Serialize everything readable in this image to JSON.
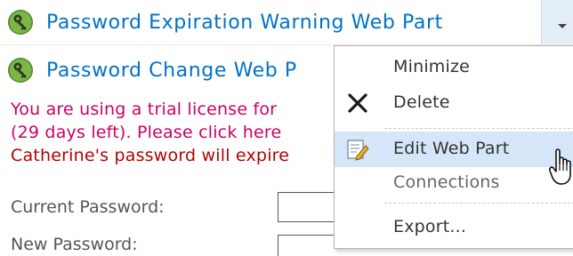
{
  "webparts": {
    "expiration_title": "Password Expiration Warning Web Part",
    "change_title": "Password Change Web P"
  },
  "messages": {
    "trial_line1": "You are using a trial license for",
    "trial_line2": "(29 days left). Please click here",
    "expire_line": "Catherine's password will expire"
  },
  "form": {
    "current_password_label": "Current Password:",
    "new_password_label": "New Password:"
  },
  "menu": {
    "minimize": "Minimize",
    "delete": "Delete",
    "edit_web_part": "Edit Web Part",
    "connections": "Connections",
    "export": "Export..."
  },
  "icons": {
    "webpart": "key-icon",
    "delete": "delete-x-icon",
    "edit": "edit-pencil-icon",
    "cursor": "hand-cursor-icon",
    "menu_arrow": "chevron-down-icon"
  },
  "colors": {
    "title_blue": "#0072c6",
    "trial_pink": "#cc0066",
    "warning_red": "#b40000",
    "menu_highlight": "#d5e6f8"
  }
}
